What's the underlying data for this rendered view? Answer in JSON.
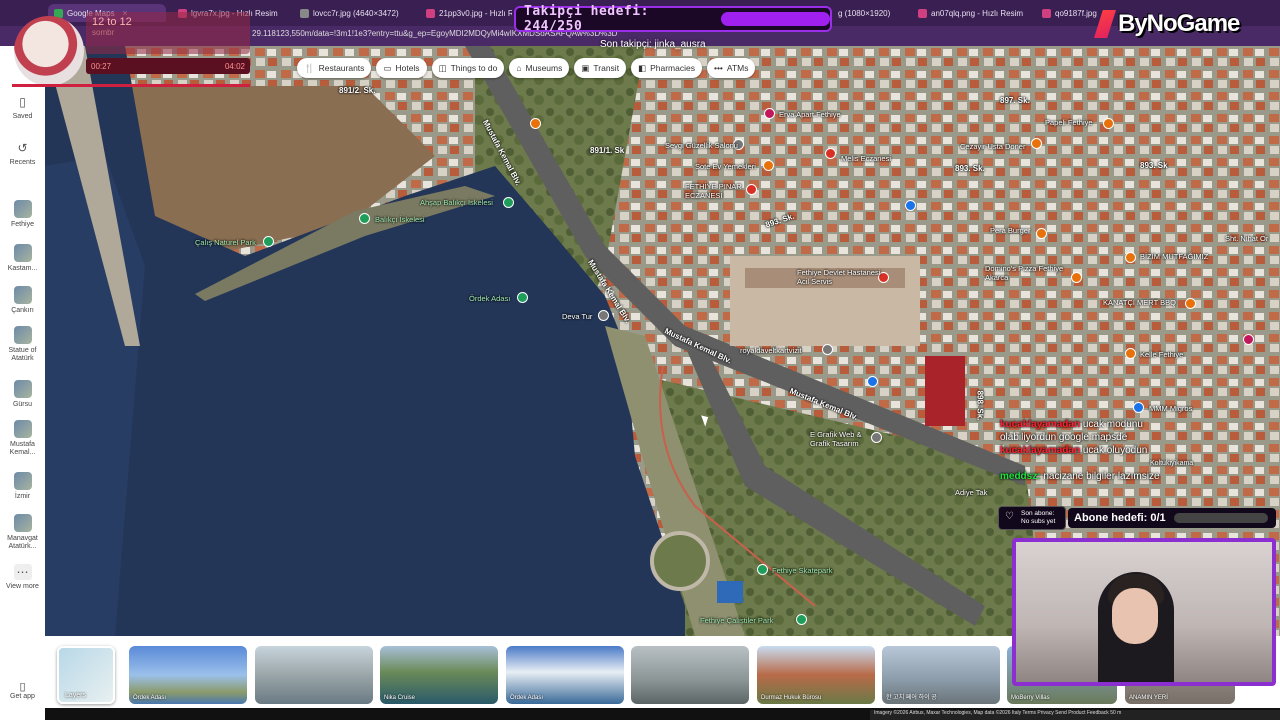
{
  "browser": {
    "tabs": [
      {
        "label": "Google Maps",
        "active": true
      },
      {
        "label": "lgvra7x.jpg - Hızlı Resim"
      },
      {
        "label": "lovcc7r.jpg (4640×3472)"
      },
      {
        "label": "21pp3v0.jpg - Hızlı Resim"
      },
      {
        "label": "g (1080×1920)"
      },
      {
        "label": "an07qlq.png - Hızlı Resim"
      },
      {
        "label": "qo9187f.jpg - Hızlı"
      }
    ],
    "url": "29.118123,550m/data=!3m1!1e3?entry=ttu&g_ep=EgoyMDI2MDQyMi4wIKXMDSoASAFQAw%3D%3D"
  },
  "sidebar": {
    "items": [
      {
        "label": "Saved",
        "icon": "bookmark-icon"
      },
      {
        "label": "Recents",
        "icon": "history-icon"
      },
      {
        "label": "Fethiye"
      },
      {
        "label": "Kastam..."
      },
      {
        "label": "Çankırı"
      },
      {
        "label": "Statue of Atatürk"
      },
      {
        "label": "Gürsu"
      },
      {
        "label": "Mustafa Kemal..."
      },
      {
        "label": "İzmir"
      },
      {
        "label": "Manavgat Atatürk..."
      },
      {
        "label": "View more"
      }
    ],
    "get_app": "Get app"
  },
  "chips": [
    {
      "label": "Restaurants",
      "icon": "fork-knife-icon"
    },
    {
      "label": "Hotels",
      "icon": "bed-icon"
    },
    {
      "label": "Things to do",
      "icon": "camera-icon"
    },
    {
      "label": "Museums",
      "icon": "museum-icon"
    },
    {
      "label": "Transit",
      "icon": "train-icon"
    },
    {
      "label": "Pharmacies",
      "icon": "pill-icon"
    },
    {
      "label": "ATMs",
      "icon": "dots-icon"
    }
  ],
  "map_labels": {
    "roads": [
      "891/2. Sk.",
      "Mustafa Kemal Blv.",
      "Mustafa Kemal Blv.",
      "Mustafa Kemal Blv.",
      "Mustafa Kemal Blv.",
      "893. Sk.",
      "893. Sk.",
      "897. Sk.",
      "893. Sk",
      "891/1. Sk",
      "898. Sk."
    ],
    "places": [
      "Ahşap Balıkçı İskelesi",
      "Balıkçı İskelesi",
      "Çalış Naturel Park",
      "Ördek Adası",
      "Deva Tur",
      "Sevgi Güzellik Salonu",
      "Sote Ev Yemekleri",
      "FETHİYE PINAR ECZANESİ",
      "Erva Apart Fethiye",
      "Melis Eczanesi",
      "Cezayir Usta Doner",
      "Papeli Fethiye",
      "Fethiye Devlet Hastanesi Acil Servis",
      "Pera Burger",
      "Domino's Pizza Fethiye Akarca",
      "BİZİM MUTFAĞIMIZ",
      "KANATÇI MERT BBQ",
      "Kelle Fethiye",
      "MMM Migros",
      "royaldaveltkartvizit",
      "E Grafik Web & Grafik Tasarım",
      "Adiye Tak",
      "Fethiye Skatepark",
      "Fethiye Çalıştiler Park",
      "Sht. Nihat Ör"
    ]
  },
  "stream": {
    "follow_goal": "Takipçi hedefi: 244/250",
    "last_follower": "Son takipçi: jinka_ausra",
    "brand": "ByNoGame",
    "song_title": "12 to 12",
    "song_artist": "sombr",
    "time_elapsed": "00:27",
    "time_total": "04:02",
    "chat": [
      {
        "nick": "kucaklayamadan",
        "msg": "ucak modunu"
      },
      {
        "nick": "",
        "msg": "olabiliyordun google mapsde"
      },
      {
        "nick": "kucaklayamadan",
        "msg": "ucak oluyodun"
      },
      {
        "nick": "",
        "msg": "Koltukiyikama"
      },
      {
        "nick": "meddsz:",
        "msg": "nacizane bilgiler lazımsize"
      }
    ],
    "sub_last": "Son abone:",
    "sub_last_value": "No subs yet",
    "sub_goal": "Abone hedefi: 0/1"
  },
  "photos": [
    {
      "caption": "Layers"
    },
    {
      "caption": "Ördek Adası"
    },
    {
      "caption": ""
    },
    {
      "caption": "Nika Cruise"
    },
    {
      "caption": "Ördek Adası"
    },
    {
      "caption": ""
    },
    {
      "caption": "Durmaz Hukuk Bürosu"
    },
    {
      "caption": "한 고치 페어 하이 공"
    },
    {
      "caption": "MoBerry Villas"
    },
    {
      "caption": "ANAMIN YERİ"
    }
  ],
  "footer": "Imagery ©2026 Airbus, Maxar Technologies, Map data ©2026   Italy   Terms   Privacy   Send Product Feedback   50 m",
  "progress": {
    "follow_goal_fraction": 0.976,
    "sub_goal_fraction": 0.0
  }
}
